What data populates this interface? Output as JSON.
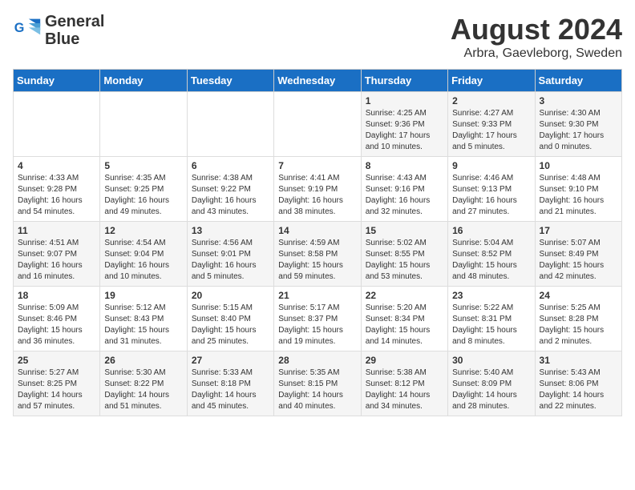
{
  "header": {
    "logo_line1": "General",
    "logo_line2": "Blue",
    "month_year": "August 2024",
    "location": "Arbra, Gaevleborg, Sweden"
  },
  "days_of_week": [
    "Sunday",
    "Monday",
    "Tuesday",
    "Wednesday",
    "Thursday",
    "Friday",
    "Saturday"
  ],
  "weeks": [
    [
      {
        "day": "",
        "info": ""
      },
      {
        "day": "",
        "info": ""
      },
      {
        "day": "",
        "info": ""
      },
      {
        "day": "",
        "info": ""
      },
      {
        "day": "1",
        "info": "Sunrise: 4:25 AM\nSunset: 9:36 PM\nDaylight: 17 hours\nand 10 minutes."
      },
      {
        "day": "2",
        "info": "Sunrise: 4:27 AM\nSunset: 9:33 PM\nDaylight: 17 hours\nand 5 minutes."
      },
      {
        "day": "3",
        "info": "Sunrise: 4:30 AM\nSunset: 9:30 PM\nDaylight: 17 hours\nand 0 minutes."
      }
    ],
    [
      {
        "day": "4",
        "info": "Sunrise: 4:33 AM\nSunset: 9:28 PM\nDaylight: 16 hours\nand 54 minutes."
      },
      {
        "day": "5",
        "info": "Sunrise: 4:35 AM\nSunset: 9:25 PM\nDaylight: 16 hours\nand 49 minutes."
      },
      {
        "day": "6",
        "info": "Sunrise: 4:38 AM\nSunset: 9:22 PM\nDaylight: 16 hours\nand 43 minutes."
      },
      {
        "day": "7",
        "info": "Sunrise: 4:41 AM\nSunset: 9:19 PM\nDaylight: 16 hours\nand 38 minutes."
      },
      {
        "day": "8",
        "info": "Sunrise: 4:43 AM\nSunset: 9:16 PM\nDaylight: 16 hours\nand 32 minutes."
      },
      {
        "day": "9",
        "info": "Sunrise: 4:46 AM\nSunset: 9:13 PM\nDaylight: 16 hours\nand 27 minutes."
      },
      {
        "day": "10",
        "info": "Sunrise: 4:48 AM\nSunset: 9:10 PM\nDaylight: 16 hours\nand 21 minutes."
      }
    ],
    [
      {
        "day": "11",
        "info": "Sunrise: 4:51 AM\nSunset: 9:07 PM\nDaylight: 16 hours\nand 16 minutes."
      },
      {
        "day": "12",
        "info": "Sunrise: 4:54 AM\nSunset: 9:04 PM\nDaylight: 16 hours\nand 10 minutes."
      },
      {
        "day": "13",
        "info": "Sunrise: 4:56 AM\nSunset: 9:01 PM\nDaylight: 16 hours\nand 5 minutes."
      },
      {
        "day": "14",
        "info": "Sunrise: 4:59 AM\nSunset: 8:58 PM\nDaylight: 15 hours\nand 59 minutes."
      },
      {
        "day": "15",
        "info": "Sunrise: 5:02 AM\nSunset: 8:55 PM\nDaylight: 15 hours\nand 53 minutes."
      },
      {
        "day": "16",
        "info": "Sunrise: 5:04 AM\nSunset: 8:52 PM\nDaylight: 15 hours\nand 48 minutes."
      },
      {
        "day": "17",
        "info": "Sunrise: 5:07 AM\nSunset: 8:49 PM\nDaylight: 15 hours\nand 42 minutes."
      }
    ],
    [
      {
        "day": "18",
        "info": "Sunrise: 5:09 AM\nSunset: 8:46 PM\nDaylight: 15 hours\nand 36 minutes."
      },
      {
        "day": "19",
        "info": "Sunrise: 5:12 AM\nSunset: 8:43 PM\nDaylight: 15 hours\nand 31 minutes."
      },
      {
        "day": "20",
        "info": "Sunrise: 5:15 AM\nSunset: 8:40 PM\nDaylight: 15 hours\nand 25 minutes."
      },
      {
        "day": "21",
        "info": "Sunrise: 5:17 AM\nSunset: 8:37 PM\nDaylight: 15 hours\nand 19 minutes."
      },
      {
        "day": "22",
        "info": "Sunrise: 5:20 AM\nSunset: 8:34 PM\nDaylight: 15 hours\nand 14 minutes."
      },
      {
        "day": "23",
        "info": "Sunrise: 5:22 AM\nSunset: 8:31 PM\nDaylight: 15 hours\nand 8 minutes."
      },
      {
        "day": "24",
        "info": "Sunrise: 5:25 AM\nSunset: 8:28 PM\nDaylight: 15 hours\nand 2 minutes."
      }
    ],
    [
      {
        "day": "25",
        "info": "Sunrise: 5:27 AM\nSunset: 8:25 PM\nDaylight: 14 hours\nand 57 minutes."
      },
      {
        "day": "26",
        "info": "Sunrise: 5:30 AM\nSunset: 8:22 PM\nDaylight: 14 hours\nand 51 minutes."
      },
      {
        "day": "27",
        "info": "Sunrise: 5:33 AM\nSunset: 8:18 PM\nDaylight: 14 hours\nand 45 minutes."
      },
      {
        "day": "28",
        "info": "Sunrise: 5:35 AM\nSunset: 8:15 PM\nDaylight: 14 hours\nand 40 minutes."
      },
      {
        "day": "29",
        "info": "Sunrise: 5:38 AM\nSunset: 8:12 PM\nDaylight: 14 hours\nand 34 minutes."
      },
      {
        "day": "30",
        "info": "Sunrise: 5:40 AM\nSunset: 8:09 PM\nDaylight: 14 hours\nand 28 minutes."
      },
      {
        "day": "31",
        "info": "Sunrise: 5:43 AM\nSunset: 8:06 PM\nDaylight: 14 hours\nand 22 minutes."
      }
    ]
  ]
}
